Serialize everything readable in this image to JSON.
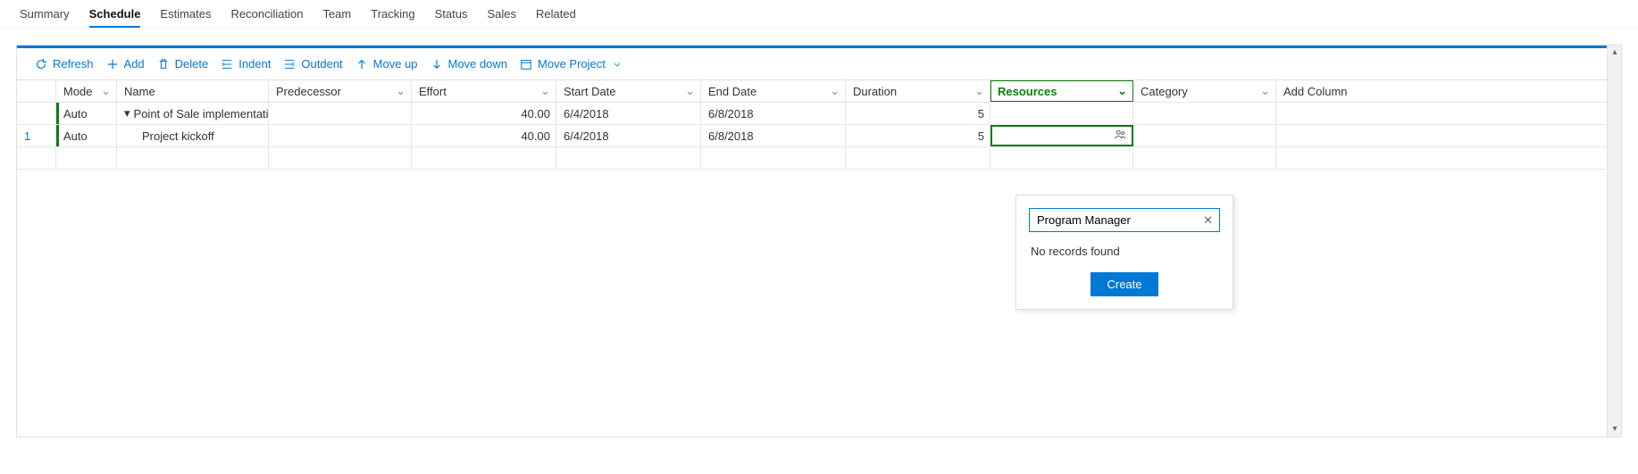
{
  "tabs": [
    "Summary",
    "Schedule",
    "Estimates",
    "Reconciliation",
    "Team",
    "Tracking",
    "Status",
    "Sales",
    "Related"
  ],
  "active_tab": "Schedule",
  "toolbar": {
    "refresh": "Refresh",
    "add": "Add",
    "delete": "Delete",
    "indent": "Indent",
    "outdent": "Outdent",
    "moveup": "Move up",
    "movedown": "Move down",
    "moveproject": "Move Project"
  },
  "columns": {
    "mode": "Mode",
    "name": "Name",
    "predecessor": "Predecessor",
    "effort": "Effort",
    "startdate": "Start Date",
    "enddate": "End Date",
    "duration": "Duration",
    "resources": "Resources",
    "category": "Category",
    "addcolumn": "Add Column"
  },
  "rows": [
    {
      "rownum": "",
      "mode": "Auto",
      "name": "Point of Sale implementati",
      "predecessor": "",
      "effort": "40.00",
      "startdate": "6/4/2018",
      "enddate": "6/8/2018",
      "duration": "5",
      "resources": "",
      "category": "",
      "expandable": true
    },
    {
      "rownum": "1",
      "mode": "Auto",
      "name": "Project kickoff",
      "predecessor": "",
      "effort": "40.00",
      "startdate": "6/4/2018",
      "enddate": "6/8/2018",
      "duration": "5",
      "resources": "",
      "category": "",
      "indent": true,
      "active_resource": true
    }
  ],
  "flyout": {
    "value": "Program Manager",
    "message": "No records found",
    "create": "Create"
  }
}
